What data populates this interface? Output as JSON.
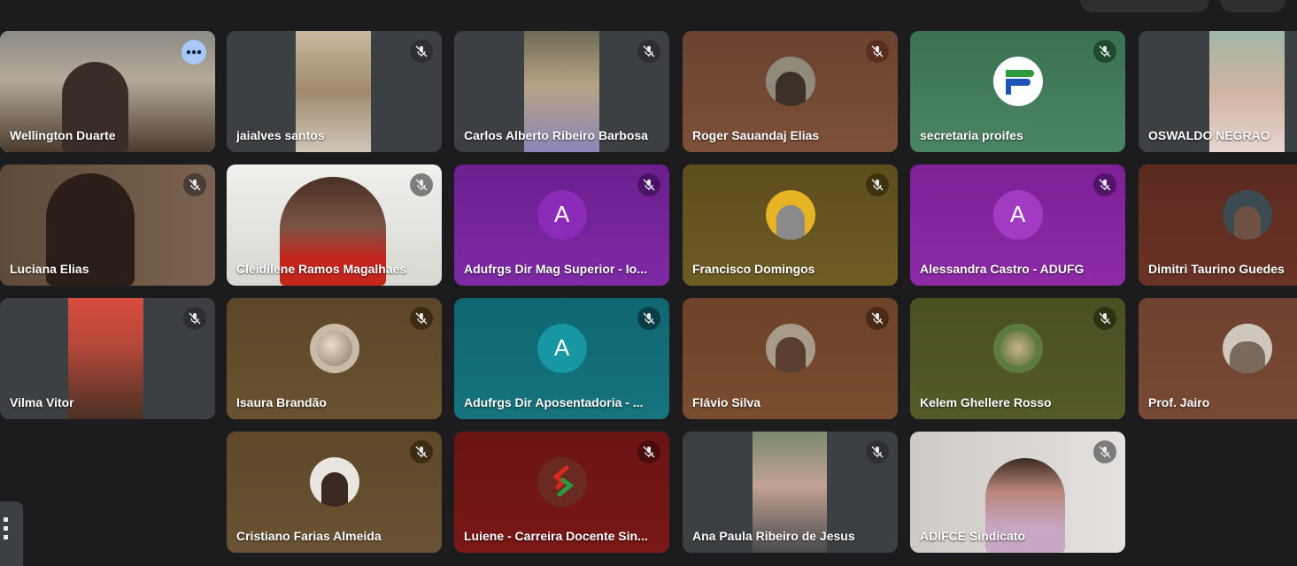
{
  "participants": [
    {
      "name": "Wellington Duarte",
      "mic": "host",
      "bg": "#6f5f4a"
    },
    {
      "name": "jaialves santos",
      "mic": "muted",
      "bg": "#3c4043"
    },
    {
      "name": "Carlos Alberto Ribeiro Barbosa",
      "mic": "muted",
      "bg": "#3c4043"
    },
    {
      "name": "Roger Sauandaj Elias",
      "mic": "muted",
      "bg": "#7a4d33"
    },
    {
      "name": "secretaria proifes",
      "mic": "muted",
      "bg": "#3f7a57"
    },
    {
      "name": "OSWALDO NEGRAO",
      "mic": "muted",
      "bg": "#3c4043"
    },
    {
      "name": "Luciana Elias",
      "mic": "muted",
      "bg": "#6a5543"
    },
    {
      "name": "Cleidilene Ramos Magalhaes",
      "mic": "muted",
      "bg": "#e2e2dc"
    },
    {
      "name": "Adufrgs Dir Mag Superior - Io...",
      "mic": "muted",
      "bg": "#7e2aa6",
      "initial": "A"
    },
    {
      "name": "Francisco Domingos",
      "mic": "muted",
      "bg": "#6e5c24"
    },
    {
      "name": "Alessandra Castro - ADUFG",
      "mic": "muted",
      "bg": "#8e2aa6",
      "initial": "A"
    },
    {
      "name": "Dimitri Taurino Guedes",
      "mic": "muted",
      "bg": "#6a3325"
    },
    {
      "name": "Vilma Vitor",
      "mic": "muted",
      "bg": "#3c4043"
    },
    {
      "name": "Isaura Brandão",
      "mic": "muted",
      "bg": "#6a5330"
    },
    {
      "name": "Adufrgs Dir Aposentadoria - ...",
      "mic": "muted",
      "bg": "#15747e",
      "initial": "A"
    },
    {
      "name": "Flávio Silva",
      "mic": "muted",
      "bg": "#7a4d30"
    },
    {
      "name": "Kelem Ghellere Rosso",
      "mic": "muted",
      "bg": "#555a28"
    },
    {
      "name": "Prof. Jairo",
      "mic": "muted",
      "bg": "#784a35"
    },
    {
      "name": "Cristiano Farias Almeida",
      "mic": "muted",
      "bg": "#6a5334"
    },
    {
      "name": "Luiene - Carreira Docente Sin...",
      "mic": "muted",
      "bg": "#7a1717"
    },
    {
      "name": "Ana Paula Ribeiro de Jesus",
      "mic": "muted",
      "bg": "#3c4043"
    },
    {
      "name": "ADIFCE Sindicato",
      "mic": "muted",
      "bg": "#d8d4d2"
    }
  ]
}
